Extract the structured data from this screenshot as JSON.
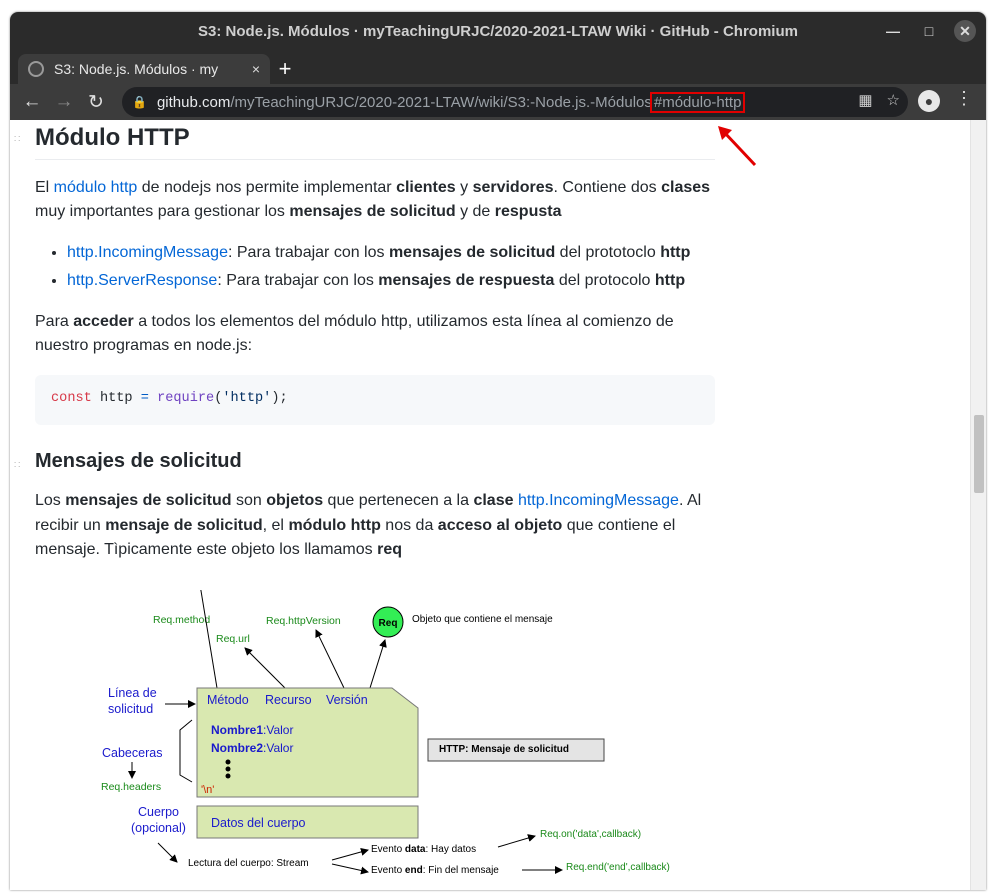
{
  "window": {
    "title": "S3: Node.js. Módulos · myTeachingURJC/2020-2021-LTAW Wiki · GitHub - Chromium"
  },
  "tab": {
    "title": "S3: Node.js. Módulos · my",
    "close": "×"
  },
  "toolbar": {
    "back": "←",
    "forward": "→",
    "reload": "↻",
    "new_tab": "+",
    "url_host": "github.com",
    "url_path": "/myTeachingURJC/2020-2021-LTAW/wiki/S3:-Node.js.-Módulos",
    "url_hash": "#módulo-http"
  },
  "article": {
    "h_modulo": "Módulo HTTP",
    "p1": {
      "t1": "El ",
      "link": "módulo http",
      "t2": " de nodejs nos permite implementar ",
      "b1": "clientes",
      "t3": " y ",
      "b2": "servidores",
      "t4": ". Contiene dos ",
      "b3": "clases",
      "t5": " muy importantes para gestionar los ",
      "b4": "mensajes de solicitud",
      "t6": " y de ",
      "b5": "respusta"
    },
    "li1": {
      "link": "http.IncomingMessage",
      "t1": ": Para trabajar con los ",
      "b1": "mensajes de solicitud",
      "t2": " del prototoclo ",
      "b2": "http"
    },
    "li2": {
      "link": "http.ServerResponse",
      "t1": ": Para trabajar con los ",
      "b1": "mensajes de respuesta",
      "t2": " del protocolo ",
      "b2": "http"
    },
    "p2": {
      "t1": "Para ",
      "b1": "acceder",
      "t2": " a todos los elementos del módulo http, utilizamos esta línea al comienzo de nuestro programas en node.js:"
    },
    "code": {
      "kw": "const",
      "var": " http ",
      "op": "=",
      "fn": " require",
      "p1": "(",
      "str": "'http'",
      "p2": ");"
    },
    "h_mensajes": "Mensajes de solicitud",
    "p3": {
      "t1": "Los ",
      "b1": "mensajes de solicitud",
      "t2": " son ",
      "b2": "objetos",
      "t3": " que pertenecen a la ",
      "b3": "clase",
      "t4": " ",
      "link": "http.IncomingMessage",
      "t5": ". Al recibir un ",
      "b4": "mensaje de solicitud",
      "t6": ", el ",
      "b5": "módulo http",
      "t7": " nos da ",
      "b6": "acceso al objeto",
      "t8": " que contiene el mensaje. Tìpicamente este objeto los llamamos ",
      "b7": "req"
    }
  },
  "diagram": {
    "req_method": "Req.method",
    "req_url": "Req.url",
    "req_httpversion": "Req.httpVersion",
    "req_circle": "Req",
    "objeto_label": "Objeto que contiene el mensaje",
    "linea_solicitud_1": "Línea de",
    "linea_solicitud_2": "solicitud",
    "metodo": "Método",
    "recurso": "Recurso",
    "version": "Versión",
    "nombre1": "Nombre1",
    "nombre2": "Nombre2",
    "valor": ":Valor",
    "cabeceras": "Cabeceras",
    "req_headers": "Req.headers",
    "newline": "'\\n'",
    "http_box": "HTTP: Mensaje de solicitud",
    "cuerpo_1": "Cuerpo",
    "cuerpo_2": "(opcional)",
    "datos_cuerpo": "Datos del cuerpo",
    "lectura": "Lectura del cuerpo: Stream",
    "evento_data_1": "Evento ",
    "evento_data_b": "data",
    "evento_data_2": ": Hay datos",
    "evento_end_1": "Evento ",
    "evento_end_b": "end",
    "evento_end_2": ": Fin del mensaje",
    "req_on": "Req.on('data',callback)",
    "req_end": "Req.end('end',callback)"
  },
  "colors": {
    "link": "#0366d6",
    "diagram_green": "#1a8a1a",
    "diagram_blue": "#1a1acc",
    "box_fill": "#d9e8b0",
    "highlight": "#e10000"
  }
}
